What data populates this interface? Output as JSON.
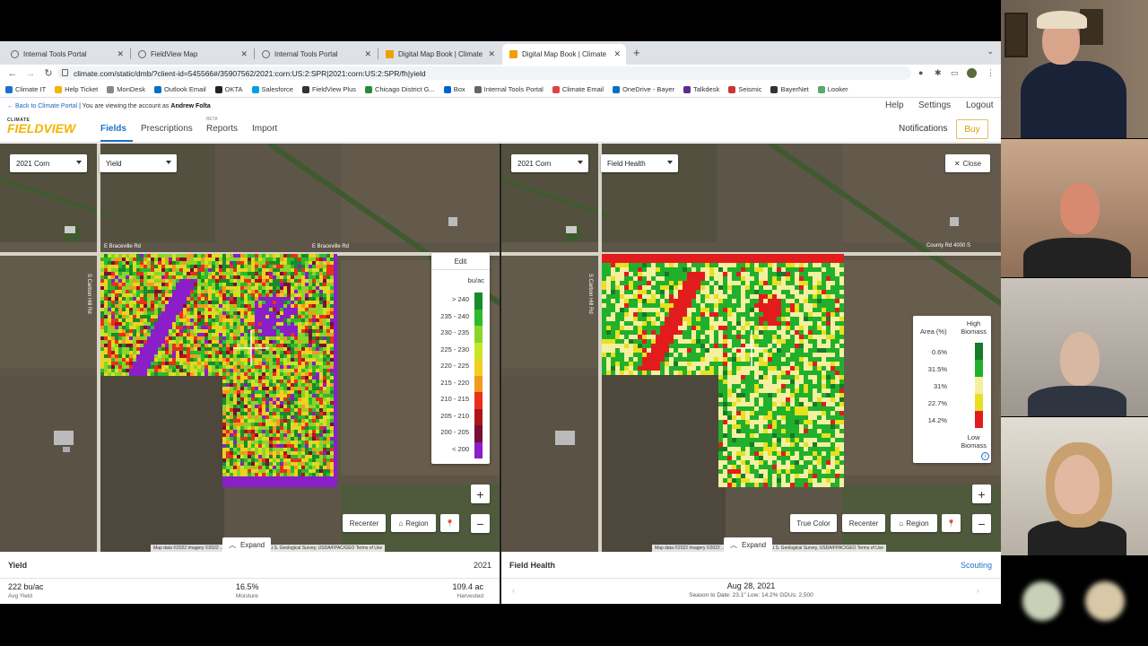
{
  "browser": {
    "tabs": [
      {
        "label": "Internal Tools Portal",
        "active": false
      },
      {
        "label": "FieldView Map",
        "active": false
      },
      {
        "label": "Internal Tools Portal",
        "active": false
      },
      {
        "label": "Digital Map Book | Climate Fiel",
        "active": false
      },
      {
        "label": "Digital Map Book | Climate Fiel",
        "active": true
      }
    ],
    "url": "climate.com/static/dmb/?client-id=545566#/35907562/2021:corn:US:2:SPR|2021:corn:US:2:SPR/fh|yield",
    "bookmarks": [
      "Climate IT",
      "Help Ticket",
      "MonDesk",
      "Outlook Email",
      "OKTA",
      "Salesforce",
      "FieldView Plus",
      "Chicago District G...",
      "Box",
      "Internal Tools Portal",
      "Climate Email",
      "OneDrive - Bayer",
      "Talkdesk",
      "Seismic",
      "BayerNet",
      "Looker"
    ]
  },
  "app": {
    "back_link": "← Back to Climate Portal",
    "viewing_text": "| You are viewing the account as",
    "account_name": "Andrew Folta",
    "top_links": [
      "Help",
      "Settings",
      "Logout"
    ],
    "logo_top": "CLIMATE",
    "logo_main": "FIELDVIEW",
    "menu": [
      "Fields",
      "Prescriptions",
      "Reports",
      "Import"
    ],
    "beta_tag": "BETA",
    "notifications": "Notifications",
    "buy": "Buy"
  },
  "left_map": {
    "season": "2021 Corn",
    "layer": "Yield",
    "roads": {
      "top": "E Braceville Rd",
      "side": "S Carbon Hill Rd"
    },
    "legend_edit": "Edit",
    "legend_unit": "bu/ac",
    "legend": [
      {
        "label": "> 240",
        "color": "#1a8a2a"
      },
      {
        "label": "235 - 240",
        "color": "#2dba2d"
      },
      {
        "label": "230 - 235",
        "color": "#88d62a"
      },
      {
        "label": "225 - 230",
        "color": "#c8e628"
      },
      {
        "label": "220 - 225",
        "color": "#f0d020"
      },
      {
        "label": "215 - 220",
        "color": "#f39a1e"
      },
      {
        "label": "210 - 215",
        "color": "#e8301c"
      },
      {
        "label": "205 - 210",
        "color": "#b01418"
      },
      {
        "label": "200 - 205",
        "color": "#7a0e3a"
      },
      {
        "label": "< 200",
        "color": "#8a1ec8"
      }
    ],
    "buttons": {
      "recenter": "Recenter",
      "region": "Region",
      "expand": "Expand",
      "zoom_in": "+",
      "zoom_out": "−"
    },
    "attribution": "Map data ©2022 Imagery ©2022 ... , Maxar Technologies, U.S. Geological Survey, USDA/FPAC/GEO   Terms of Use"
  },
  "right_map": {
    "season": "2021 Corn",
    "layer": "Field Health",
    "close": "Close",
    "roads": {
      "top": "County Rd 4000 S",
      "side": "S Carbon Hill Rd"
    },
    "legend_area_head": "Area (%)",
    "legend_high": "High\nBiomass",
    "legend_low": "Low\nBiomass",
    "legend": [
      {
        "label": "0.6%",
        "color": "#157a2a"
      },
      {
        "label": "31.5%",
        "color": "#21b02b"
      },
      {
        "label": "31%",
        "color": "#f4f0a0"
      },
      {
        "label": "22.7%",
        "color": "#e8e020"
      },
      {
        "label": "14.2%",
        "color": "#e21c1c"
      }
    ],
    "buttons": {
      "true_color": "True Color",
      "recenter": "Recenter",
      "region": "Region",
      "expand": "Expand",
      "zoom_in": "+",
      "zoom_out": "−"
    },
    "attribution": "Map data ©2022 Imagery ©2022 ... , Maxar Technologies, U.S. Geological Survey, USDA/FPAC/GEO   Terms of Use"
  },
  "yield_panel": {
    "title": "Yield",
    "year": "2021",
    "stats": [
      {
        "value": "222 bu/ac",
        "label": "Avg Yield"
      },
      {
        "value": "16.5%",
        "label": "Moisture"
      },
      {
        "value": "109.4 ac",
        "label": "Harvested"
      }
    ]
  },
  "health_panel": {
    "title": "Field Health",
    "scouting": "Scouting",
    "date": "Aug 28, 2021",
    "summary": "Season to Date: 23.1\" Low: 14.2% GDUs: 2,500"
  },
  "colors": {
    "accent": "#1a73c8",
    "brand": "#f4b400"
  }
}
